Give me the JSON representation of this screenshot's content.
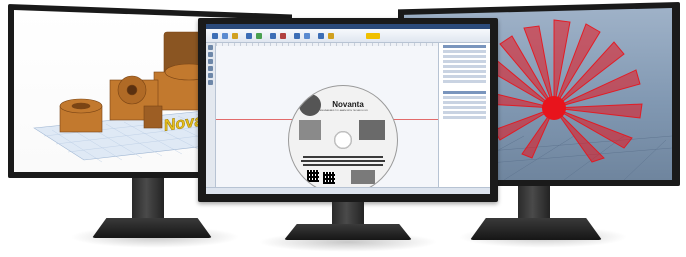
{
  "scene": {
    "monitors": [
      {
        "id": "left",
        "content": "3d-printed-parts-render",
        "screen_color": "#ffffff",
        "part_color": "#c2792e",
        "text_color": "#e8c21a"
      },
      {
        "id": "center",
        "content": "laser-marking-software"
      },
      {
        "id": "right",
        "content": "3d-toolpath-render",
        "screen_color": "#8ea3bb",
        "path_color": "#e8141c"
      }
    ]
  },
  "center_app": {
    "disc_brand": "Novanta",
    "disc_subtitle": "ENGINEERED TO LEARN WITH TECHNOLOGY"
  },
  "left_render": {
    "part_text": "Novan"
  }
}
